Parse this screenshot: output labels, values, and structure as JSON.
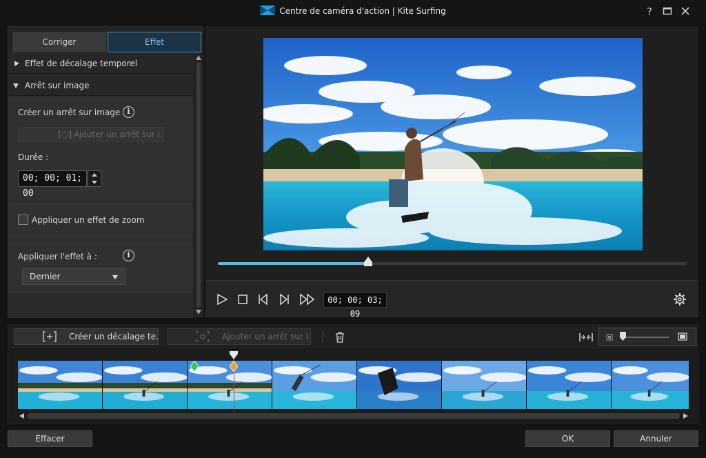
{
  "window": {
    "title": "Centre de caméra d'action  |  Kite Surfing",
    "help_symbol": "?",
    "maximize_symbol": "☐",
    "close_symbol": "✕"
  },
  "tabs": [
    {
      "label": "Corriger",
      "active": false
    },
    {
      "label": "Effet",
      "active": true
    }
  ],
  "panel": {
    "time_shift_section": "Effet de décalage temporel",
    "freeze_section": "Arrêt sur image",
    "create_freeze_label": "Créer un arrêt sur image",
    "add_freeze_button": "Ajouter un arrêt sur i...",
    "duration_label": "Durée :",
    "duration_value": "00; 00; 01; 00",
    "zoom_checkbox_label": "Appliquer un effet de zoom",
    "zoom_checked": false,
    "apply_to_label": "Appliquer l'effet à :",
    "apply_to_value": "Dernier",
    "info_symbol": "i"
  },
  "preview": {
    "progress_fraction": 0.32,
    "timecode": "00; 00; 03; 09"
  },
  "timeline_toolbar": {
    "create_time_shift_button": "Créer un décalage te...",
    "add_freeze_button": "Ajouter un arrêt sur i..."
  },
  "timeline": {
    "thumbnail_count": 8,
    "playhead_fraction": 0.321,
    "marker_green_fraction": 0.263
  },
  "footer": {
    "clear_button": "Effacer",
    "ok_button": "OK",
    "cancel_button": "Annuler"
  },
  "colors": {
    "accent": "#5cb8e6",
    "marker_green": "#2ecc55",
    "marker_orange": "#f0a030",
    "playhead": "#e03030"
  }
}
